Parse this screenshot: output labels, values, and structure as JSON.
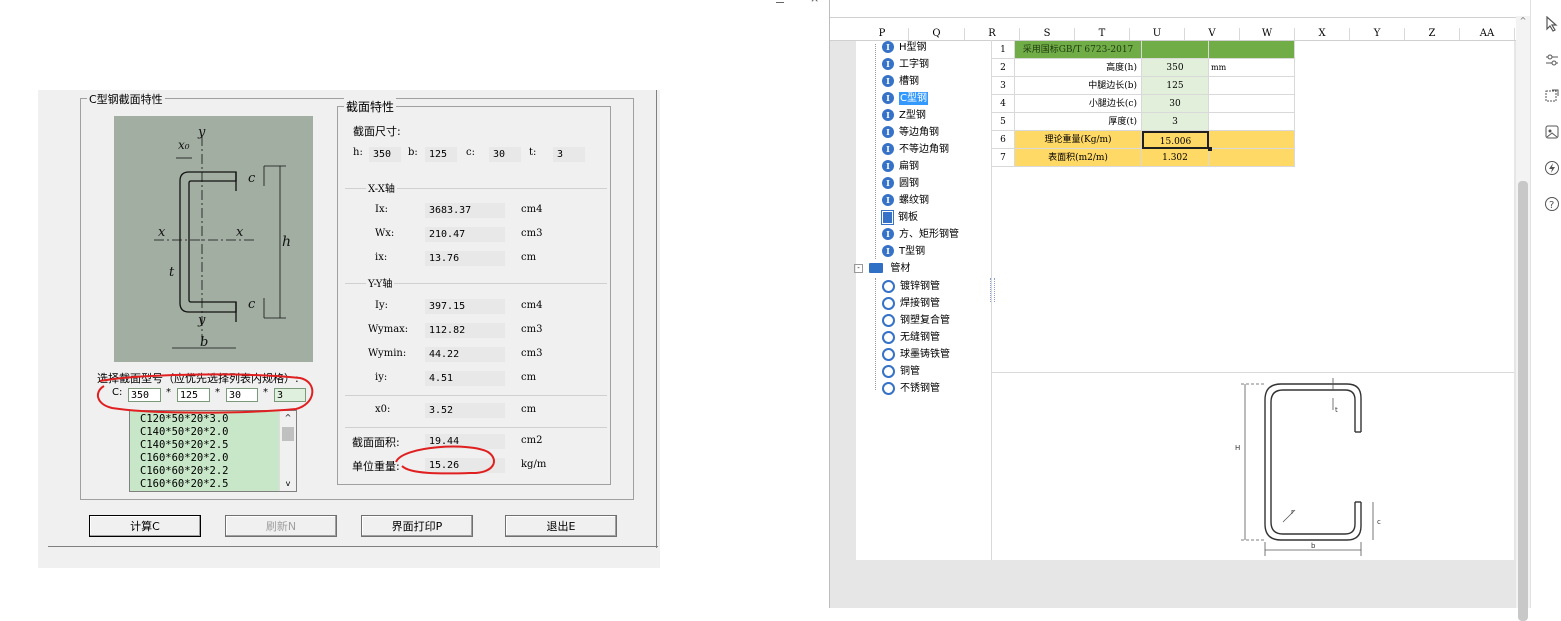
{
  "dialog": {
    "group_title": "C型钢截面特性",
    "props_title": "截面特性",
    "section_size_label": "截面尺寸:",
    "dims": [
      {
        "label": "h:",
        "value": "350"
      },
      {
        "label": "b:",
        "value": "125"
      },
      {
        "label": "c:",
        "value": "30"
      },
      {
        "label": "t:",
        "value": "3"
      }
    ],
    "xx_title": "X-X轴",
    "yy_title": "Y-Y轴",
    "props_x": [
      {
        "label": "Ix:",
        "value": "3683.37",
        "unit": "cm4"
      },
      {
        "label": "Wx:",
        "value": "210.47",
        "unit": "cm3"
      },
      {
        "label": "ix:",
        "value": "13.76",
        "unit": "cm"
      }
    ],
    "props_y": [
      {
        "label": "Iy:",
        "value": "397.15",
        "unit": "cm4"
      },
      {
        "label": "Wymax:",
        "value": "112.82",
        "unit": "cm3"
      },
      {
        "label": "Wymin:",
        "value": "44.22",
        "unit": "cm3"
      },
      {
        "label": "iy:",
        "value": "4.51",
        "unit": "cm"
      }
    ],
    "x0": {
      "label": "x0:",
      "value": "3.52",
      "unit": "cm"
    },
    "area": {
      "label": "截面面积:",
      "value": "19.44",
      "unit": "cm2"
    },
    "weight": {
      "label": "单位重量:",
      "value": "15.26",
      "unit": "kg/m"
    },
    "select_label": "选择截面型号（应优先选择列表内规格）:",
    "c_label": "C:",
    "inputs": [
      "350",
      "125",
      "30",
      "3"
    ],
    "star": "*",
    "list_items": [
      "C120*50*20*3.0",
      "C140*50*20*2.0",
      "C140*50*20*2.5",
      "C160*60*20*2.0",
      "C160*60*20*2.2",
      "C160*60*20*2.5"
    ],
    "buttons": {
      "calc": "计算C",
      "refresh": "刷新N",
      "print": "界面打印P",
      "exit": "退出E"
    },
    "diagram": {
      "y": "y",
      "x": "x",
      "x0": "x₀",
      "c": "c",
      "h": "h",
      "t": "t",
      "b": "b"
    }
  },
  "sheet": {
    "col_headers": [
      "P",
      "Q",
      "R",
      "S",
      "T",
      "U",
      "V",
      "W",
      "X",
      "Y",
      "Z",
      "AA"
    ],
    "tree": [
      {
        "type": "I",
        "label": "H型钢"
      },
      {
        "type": "I",
        "label": "工字钢"
      },
      {
        "type": "I",
        "label": "槽钢"
      },
      {
        "type": "I",
        "label": "C型钢",
        "selected": true
      },
      {
        "type": "I",
        "label": "Z型钢"
      },
      {
        "type": "I",
        "label": "等边角钢"
      },
      {
        "type": "I",
        "label": "不等边角钢"
      },
      {
        "type": "I",
        "label": "扁钢"
      },
      {
        "type": "I",
        "label": "圆钢"
      },
      {
        "type": "I",
        "label": "螺纹钢"
      },
      {
        "type": "P",
        "label": "钢板"
      },
      {
        "type": "I",
        "label": "方、矩形钢管"
      },
      {
        "type": "I",
        "label": "T型钢"
      }
    ],
    "tube_folder": "管材",
    "tubes": [
      "镀锌钢管",
      "焊接钢管",
      "钢塑复合管",
      "无缝钢管",
      "球墨铸铁管",
      "铜管",
      "不锈钢管"
    ],
    "rows": [
      {
        "num": "1",
        "label": "采用国标GB/T 6723-2017",
        "value": "",
        "extra": ""
      },
      {
        "num": "2",
        "label": "高度(h)",
        "value": "350",
        "extra": "mm"
      },
      {
        "num": "3",
        "label": "中腿边长(b)",
        "value": "125",
        "extra": ""
      },
      {
        "num": "4",
        "label": "小腿边长(c)",
        "value": "30",
        "extra": ""
      },
      {
        "num": "5",
        "label": "厚度(t)",
        "value": "3",
        "extra": ""
      },
      {
        "num": "6",
        "label": "理论重量(Kg/m)",
        "value": "15.006",
        "extra": ""
      },
      {
        "num": "7",
        "label": "表面积(m2/m)",
        "value": "1.302",
        "extra": ""
      }
    ],
    "drawing_labels": {
      "t": "t",
      "H": "H",
      "r": "r",
      "c": "c",
      "b": "b"
    }
  },
  "colors": {
    "header_green": "#70ad47",
    "input_green": "#e2efda",
    "calc_orange": "#ffd966",
    "annot_red": "#e02020"
  }
}
